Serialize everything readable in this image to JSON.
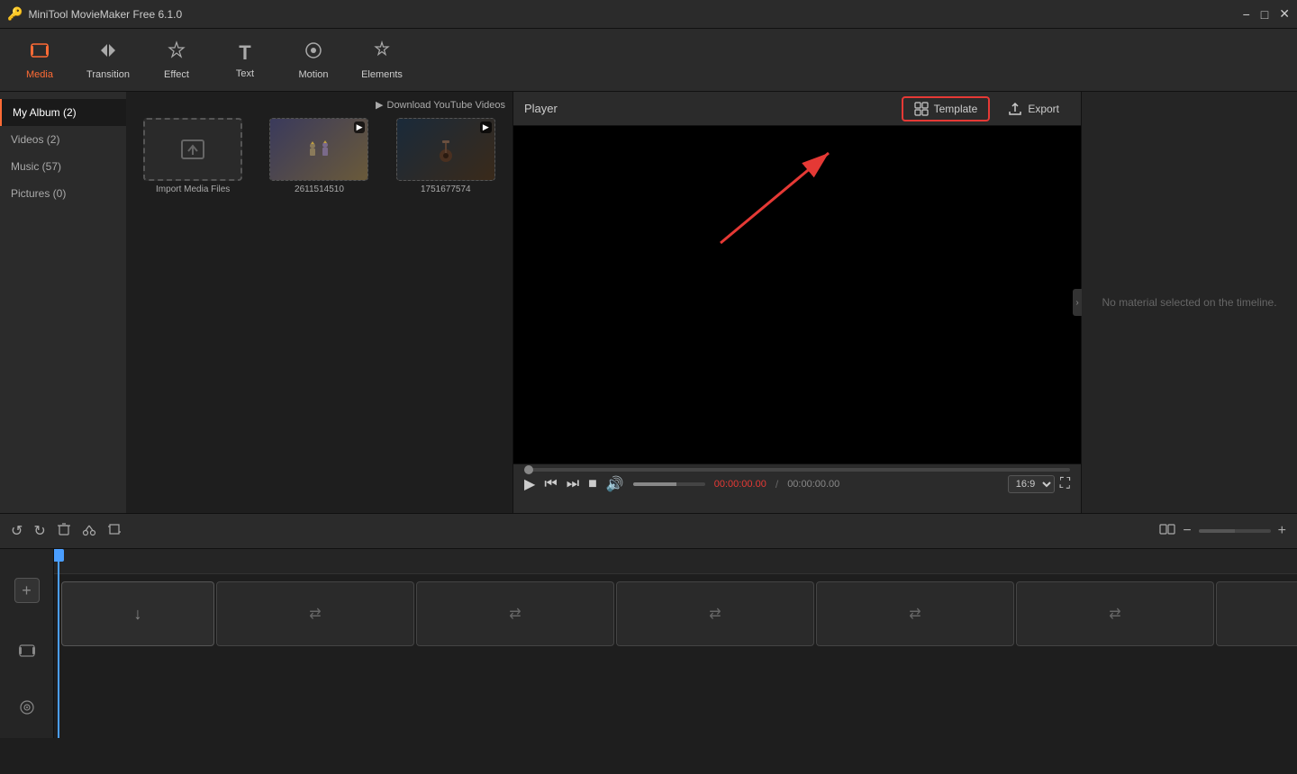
{
  "titlebar": {
    "logo": "🔑",
    "title": "MiniTool MovieMaker Free 6.1.0"
  },
  "toolbar": {
    "items": [
      {
        "id": "media",
        "label": "Media",
        "icon": "🎬",
        "active": true
      },
      {
        "id": "transition",
        "label": "Transition",
        "icon": "⇄"
      },
      {
        "id": "effect",
        "label": "Effect",
        "icon": "✦"
      },
      {
        "id": "text",
        "label": "Text",
        "icon": "T"
      },
      {
        "id": "motion",
        "label": "Motion",
        "icon": "◎"
      },
      {
        "id": "elements",
        "label": "Elements",
        "icon": "❋"
      }
    ]
  },
  "sidebar": {
    "items": [
      {
        "id": "my-album",
        "label": "My Album (2)",
        "active": true
      },
      {
        "id": "videos",
        "label": "Videos (2)"
      },
      {
        "id": "music",
        "label": "Music (57)"
      },
      {
        "id": "pictures",
        "label": "Pictures (0)"
      }
    ]
  },
  "media": {
    "download_btn": "Download YouTube Videos",
    "items": [
      {
        "id": "import",
        "label": "Import Media Files",
        "type": "import"
      },
      {
        "id": "video1",
        "label": "2611514510",
        "type": "video"
      },
      {
        "id": "video2",
        "label": "1751677574",
        "type": "video"
      }
    ]
  },
  "player": {
    "title": "Player",
    "template_btn": "Template",
    "export_btn": "Export",
    "time_current": "00:00:00.00",
    "time_total": "00:00:00.00",
    "ratio": "16:9",
    "no_material": "No material selected on the timeline."
  },
  "timeline_toolbar": {
    "undo_label": "↺",
    "redo_label": "↻",
    "delete_label": "🗑",
    "cut_label": "✂",
    "crop_label": "⊡",
    "split_label": "⊞",
    "zoom_minus": "−",
    "zoom_plus": "+"
  },
  "timeline": {
    "add_track_icon": "+"
  }
}
